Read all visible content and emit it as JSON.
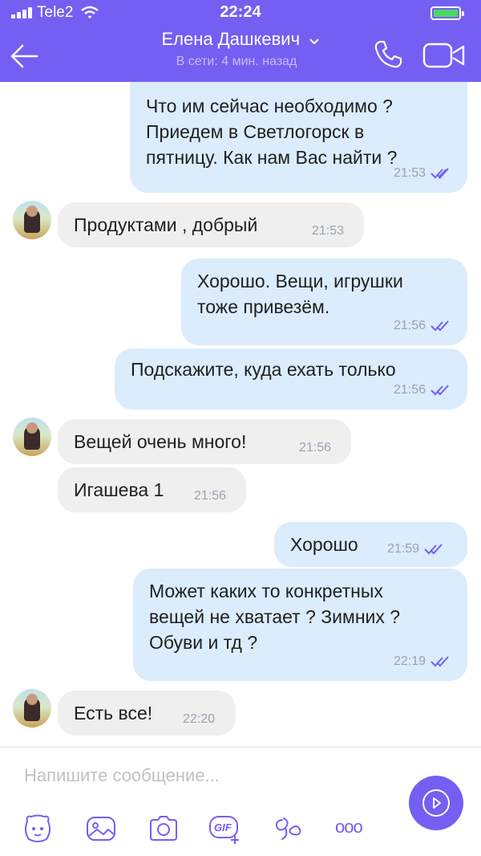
{
  "status_bar": {
    "carrier": "Tele2",
    "time": "22:24",
    "battery_color": "#4cd964"
  },
  "header": {
    "contact_name": "Елена Дашкевич",
    "presence": "В сети: 4 мин. назад",
    "background": "#7360f2",
    "icons": [
      "back-arrow-icon",
      "chevron-down-icon",
      "phone-icon",
      "video-call-icon"
    ]
  },
  "messages": [
    {
      "dir": "out",
      "text": "Что им сейчас необходимо ?\nПриедем в Светлогорск в\nпятницу. Как нам Вас найти ?",
      "time": "21:53",
      "read": true
    },
    {
      "dir": "in",
      "text": "Продуктами , добрый",
      "time": "21:53"
    },
    {
      "dir": "out",
      "text": "Хорошо. Вещи, игрушки\nтоже привезём.",
      "time": "21:56",
      "read": true
    },
    {
      "dir": "out",
      "text": "Подскажите, куда ехать только",
      "time": "21:56",
      "read": true
    },
    {
      "dir": "in",
      "text": "Вещей очень много!",
      "time": "21:56"
    },
    {
      "dir": "in",
      "text": "Игашева 1",
      "time": "21:56"
    },
    {
      "dir": "out",
      "text": "Хорошо",
      "time": "21:59",
      "read": true
    },
    {
      "dir": "out",
      "text": "Может каких то конкретных\nвещей не хватает ? Зимних ?\nОбуви и тд ?",
      "time": "22:19",
      "read": true
    },
    {
      "dir": "in",
      "text": "Есть все!",
      "time": "22:20"
    }
  ],
  "composer": {
    "placeholder": "Напишите сообщение...",
    "toolbar": [
      "sticker-icon",
      "gallery-icon",
      "camera-icon",
      "gif-icon",
      "doodle-icon",
      "more-icon"
    ],
    "gif_label": "GIF",
    "more_label": "ooo",
    "send_icon": "send-icon"
  },
  "colors": {
    "outgoing_bubble": "#dbecfd",
    "incoming_bubble": "#efefef",
    "read_ticks": "#7360f2"
  }
}
